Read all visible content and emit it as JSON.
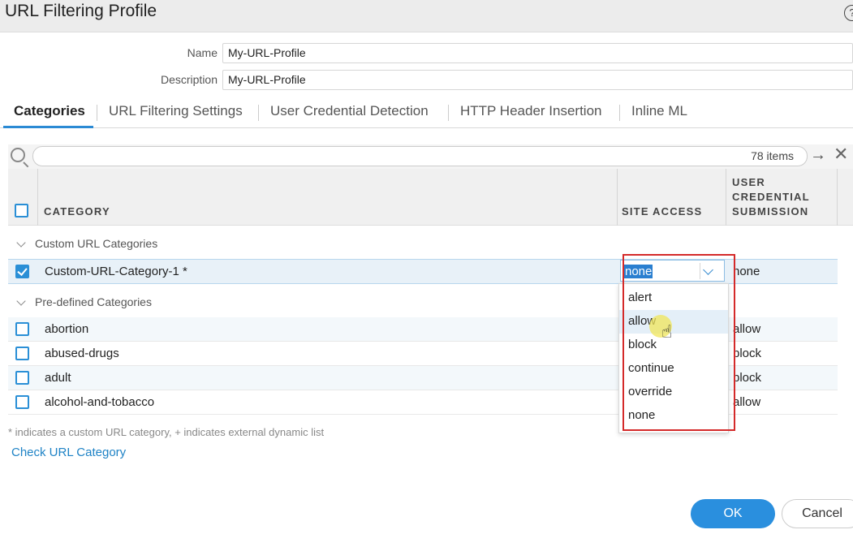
{
  "dialog": {
    "title": "URL Filtering Profile",
    "help_icon": "?"
  },
  "form": {
    "name_label": "Name",
    "name_value": "My-URL-Profile",
    "description_label": "Description",
    "description_value": "My-URL-Profile"
  },
  "tabs": [
    {
      "label": "Categories",
      "active": true
    },
    {
      "label": "URL Filtering Settings",
      "active": false
    },
    {
      "label": "User Credential Detection",
      "active": false
    },
    {
      "label": "HTTP Header Insertion",
      "active": false
    },
    {
      "label": "Inline ML",
      "active": false
    }
  ],
  "search": {
    "icon": "search-icon",
    "items_count": "78 items",
    "apply_icon": "→",
    "clear_icon": "✕"
  },
  "table": {
    "headers": {
      "category": "CATEGORY",
      "site_access": "SITE ACCESS",
      "user_credential_line1": "USER",
      "user_credential_line2": "CREDENTIAL",
      "user_credential_line3": "SUBMISSION"
    },
    "groups": [
      {
        "label": "Custom URL Categories",
        "rows": [
          {
            "category": "Custom-URL-Category-1 *",
            "site_access": "none",
            "credential": "none",
            "checked": true
          }
        ]
      },
      {
        "label": "Pre-defined Categories",
        "rows": [
          {
            "category": "abortion",
            "credential": "allow",
            "checked": false
          },
          {
            "category": "abused-drugs",
            "credential": "block",
            "checked": false
          },
          {
            "category": "adult",
            "credential": "block",
            "checked": false
          },
          {
            "category": "alcohol-and-tobacco",
            "credential": "allow",
            "checked": false
          }
        ]
      }
    ]
  },
  "dropdown": {
    "selected": "none",
    "options": [
      "alert",
      "allow",
      "block",
      "continue",
      "override",
      "none"
    ],
    "hovered": "allow"
  },
  "footer": {
    "footnote": "* indicates a custom URL category, + indicates external dynamic list",
    "check_link": "Check URL Category",
    "ok_label": "OK",
    "cancel_label": "Cancel"
  },
  "colors": {
    "accent": "#2a8fde",
    "highlight_border": "#d42a2a"
  }
}
